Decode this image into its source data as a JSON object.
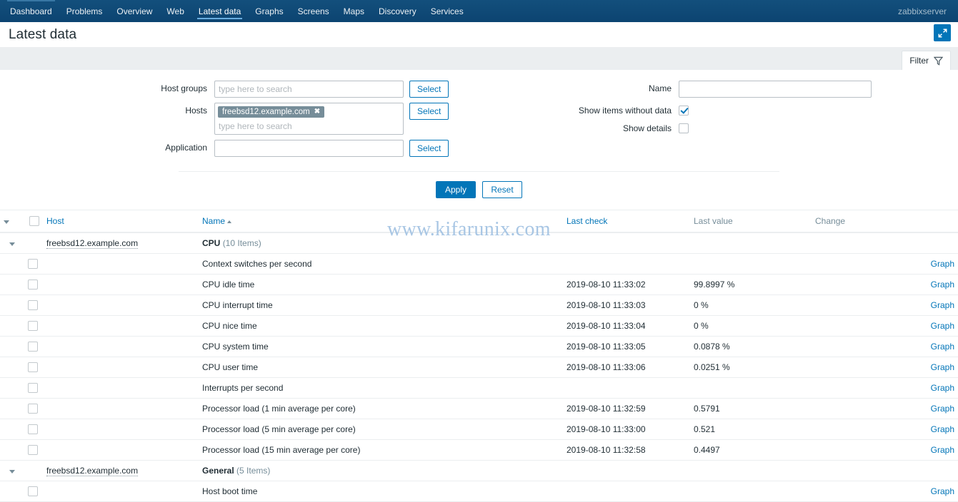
{
  "nav": {
    "items": [
      {
        "label": "Dashboard",
        "selected": false
      },
      {
        "label": "Problems",
        "selected": false
      },
      {
        "label": "Overview",
        "selected": false
      },
      {
        "label": "Web",
        "selected": false
      },
      {
        "label": "Latest data",
        "selected": true
      },
      {
        "label": "Graphs",
        "selected": false
      },
      {
        "label": "Screens",
        "selected": false
      },
      {
        "label": "Maps",
        "selected": false
      },
      {
        "label": "Discovery",
        "selected": false
      },
      {
        "label": "Services",
        "selected": false
      }
    ],
    "user": "zabbixserver"
  },
  "header": {
    "title": "Latest data",
    "kiosk_icon": "expand-arrows-icon"
  },
  "filter": {
    "tab_label": "Filter",
    "tab_icon": "funnel-icon",
    "host_groups": {
      "label": "Host groups",
      "value": "",
      "placeholder": "type here to search",
      "select_label": "Select"
    },
    "hosts": {
      "label": "Hosts",
      "chips": [
        "freebsd12.example.com"
      ],
      "chip_remove_icon": "close-icon",
      "value": "",
      "placeholder": "type here to search",
      "select_label": "Select"
    },
    "application": {
      "label": "Application",
      "value": "",
      "placeholder": "",
      "select_label": "Select"
    },
    "name": {
      "label": "Name",
      "value": "",
      "placeholder": ""
    },
    "show_items_without_data": {
      "label": "Show items without data",
      "checked": true
    },
    "show_details": {
      "label": "Show details",
      "checked": false
    },
    "apply_label": "Apply",
    "reset_label": "Reset"
  },
  "table": {
    "columns": {
      "host": "Host",
      "name": "Name",
      "name_sort": "asc",
      "last_check": "Last check",
      "last_value": "Last value",
      "change": "Change"
    },
    "graph_label": "Graph",
    "groups": [
      {
        "host": "freebsd12.example.com",
        "application": "CPU",
        "count": "(10 Items)",
        "rows": [
          {
            "name": "Context switches per second",
            "last_check": "",
            "last_value": "",
            "change": "",
            "graph": "Graph"
          },
          {
            "name": "CPU idle time",
            "last_check": "2019-08-10 11:33:02",
            "last_value": "99.8997 %",
            "change": "",
            "graph": "Graph"
          },
          {
            "name": "CPU interrupt time",
            "last_check": "2019-08-10 11:33:03",
            "last_value": "0 %",
            "change": "",
            "graph": "Graph"
          },
          {
            "name": "CPU nice time",
            "last_check": "2019-08-10 11:33:04",
            "last_value": "0 %",
            "change": "",
            "graph": "Graph"
          },
          {
            "name": "CPU system time",
            "last_check": "2019-08-10 11:33:05",
            "last_value": "0.0878 %",
            "change": "",
            "graph": "Graph"
          },
          {
            "name": "CPU user time",
            "last_check": "2019-08-10 11:33:06",
            "last_value": "0.0251 %",
            "change": "",
            "graph": "Graph"
          },
          {
            "name": "Interrupts per second",
            "last_check": "",
            "last_value": "",
            "change": "",
            "graph": "Graph"
          },
          {
            "name": "Processor load (1 min average per core)",
            "last_check": "2019-08-10 11:32:59",
            "last_value": "0.5791",
            "change": "",
            "graph": "Graph"
          },
          {
            "name": "Processor load (5 min average per core)",
            "last_check": "2019-08-10 11:33:00",
            "last_value": "0.521",
            "change": "",
            "graph": "Graph"
          },
          {
            "name": "Processor load (15 min average per core)",
            "last_check": "2019-08-10 11:32:58",
            "last_value": "0.4497",
            "change": "",
            "graph": "Graph"
          }
        ]
      },
      {
        "host": "freebsd12.example.com",
        "application": "General",
        "count": "(5 Items)",
        "rows": [
          {
            "name": "Host boot time",
            "last_check": "",
            "last_value": "",
            "change": "",
            "graph": "Graph"
          }
        ]
      }
    ]
  },
  "watermark": {
    "text": "www.kifarunix.com"
  }
}
